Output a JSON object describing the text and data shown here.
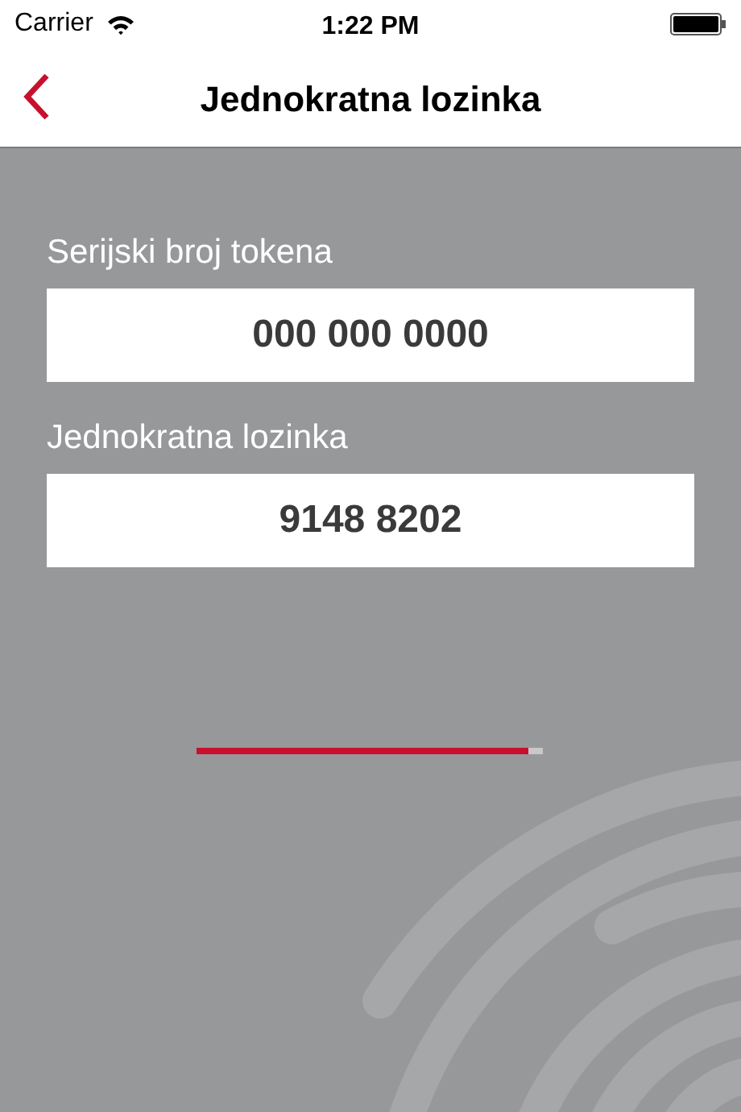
{
  "status_bar": {
    "carrier": "Carrier",
    "time": "1:22 PM"
  },
  "nav_bar": {
    "title": "Jednokratna lozinka"
  },
  "fields": [
    {
      "label": "Serijski broj tokena",
      "value": "000 000 0000"
    },
    {
      "label": "Jednokratna lozinka",
      "value": "9148 8202"
    }
  ],
  "progress": {
    "level": 0.96
  }
}
